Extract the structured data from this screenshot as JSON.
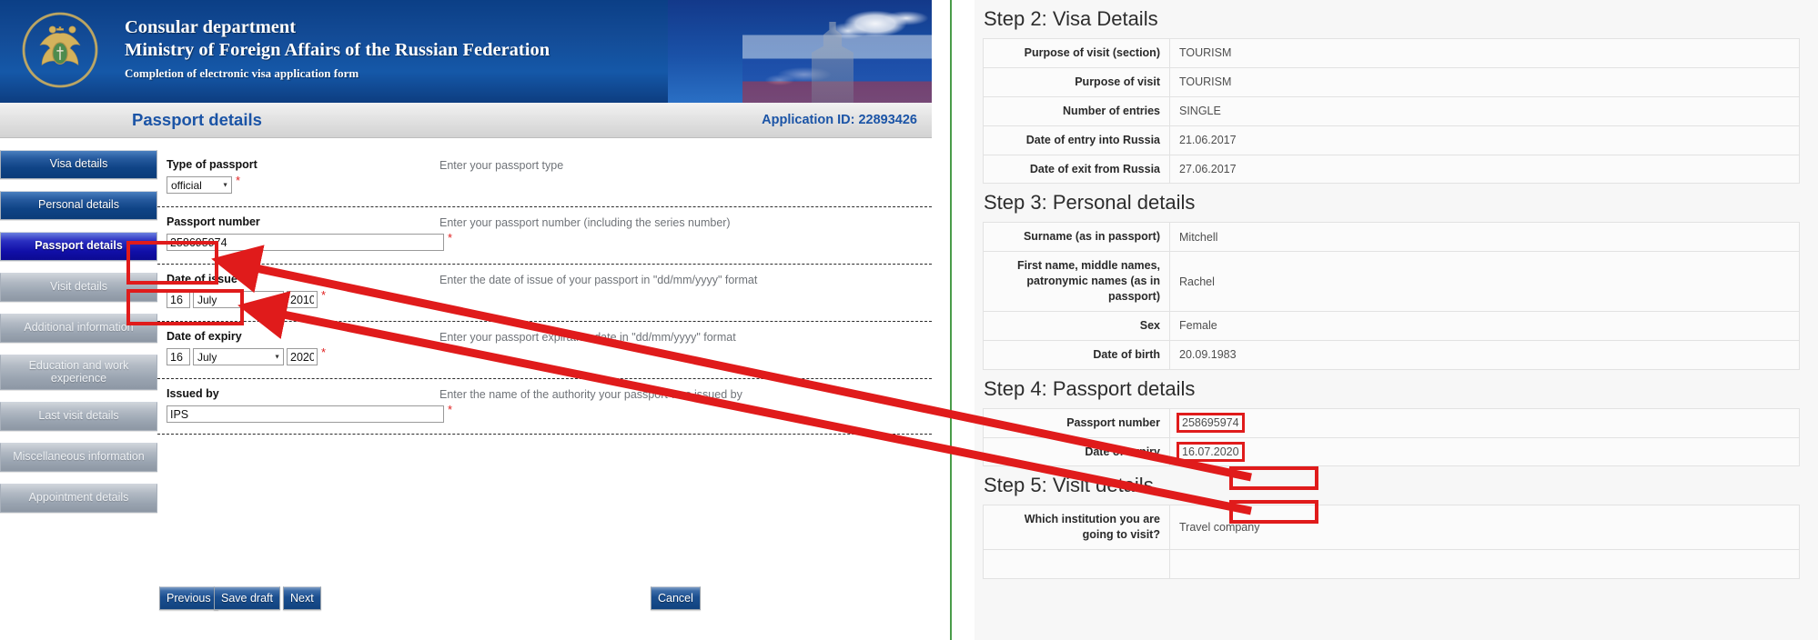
{
  "banner": {
    "line1": "Consular department",
    "line2": "Ministry of Foreign Affairs of the Russian Federation",
    "line3": "Completion of electronic visa application form",
    "emblem_alt": "russian-mfa-emblem",
    "bg_color": "#134b96"
  },
  "titlebar": {
    "title": "Passport details",
    "application_id": "Application ID: 22893426",
    "accent_color": "#1b54a6"
  },
  "sidebar": {
    "items": [
      {
        "label": "Visa details",
        "state": "done"
      },
      {
        "label": "Personal details",
        "state": "done"
      },
      {
        "label": "Passport details",
        "state": "active"
      },
      {
        "label": "Visit details",
        "state": "disabled"
      },
      {
        "label": "Additional information",
        "state": "disabled"
      },
      {
        "label": "Education and work experience",
        "state": "disabled"
      },
      {
        "label": "Last visit details",
        "state": "disabled"
      },
      {
        "label": "Miscellaneous information",
        "state": "disabled"
      },
      {
        "label": "Appointment details",
        "state": "disabled"
      }
    ]
  },
  "form": {
    "required_mark": "*",
    "rows": [
      {
        "label": "Type of passport",
        "hint": "Enter your passport type",
        "type": "select",
        "value": "official"
      },
      {
        "label": "Passport number",
        "hint": "Enter your passport number (including the series number)",
        "type": "text",
        "value": "258695974"
      },
      {
        "label": "Date of issue",
        "hint": "Enter the date of issue of your passport in \"dd/mm/yyyy\" format",
        "type": "date",
        "day": "16",
        "month": "July",
        "year": "2010"
      },
      {
        "label": "Date of expiry",
        "hint": "Enter your passport expiration date in \"dd/mm/yyyy\" format",
        "type": "date",
        "day": "16",
        "month": "July",
        "year": "2020"
      },
      {
        "label": "Issued by",
        "hint": "Enter the name of the authority your passport was issued by",
        "type": "text",
        "value": "IPS"
      }
    ]
  },
  "buttons": {
    "previous": "Previous",
    "save_draft": "Save draft",
    "next": "Next",
    "cancel": "Cancel"
  },
  "summary": {
    "steps": [
      {
        "title": "Step 2: Visa Details",
        "rows": [
          {
            "key": "Purpose of visit (section)",
            "value": "TOURISM",
            "highlight": false
          },
          {
            "key": "Purpose of visit",
            "value": "TOURISM",
            "highlight": false
          },
          {
            "key": "Number of entries",
            "value": "SINGLE",
            "highlight": false
          },
          {
            "key": "Date of entry into Russia",
            "value": "21.06.2017",
            "highlight": false
          },
          {
            "key": "Date of exit from Russia",
            "value": "27.06.2017",
            "highlight": false
          }
        ]
      },
      {
        "title": "Step 3: Personal details",
        "rows": [
          {
            "key": "Surname (as in passport)",
            "value": "Mitchell",
            "highlight": false
          },
          {
            "key": "First name, middle names, patronymic names (as in passport)",
            "value": "Rachel",
            "highlight": false
          },
          {
            "key": "Sex",
            "value": "Female",
            "highlight": false
          },
          {
            "key": "Date of birth",
            "value": "20.09.1983",
            "highlight": false
          }
        ]
      },
      {
        "title": "Step 4: Passport details",
        "rows": [
          {
            "key": "Passport number",
            "value": "258695974",
            "highlight": true
          },
          {
            "key": "Date of expiry",
            "value": "16.07.2020",
            "highlight": true
          }
        ]
      },
      {
        "title": "Step 5: Visit details",
        "rows": [
          {
            "key": "Which institution you are going to visit?",
            "value": "Travel company",
            "highlight": false
          }
        ]
      }
    ]
  },
  "annotation": {
    "color": "#e01b1b",
    "divider_color": "#4a9c4a",
    "boxes": [
      {
        "name": "passport-number-field-highlight"
      },
      {
        "name": "date-of-expiry-field-highlight"
      },
      {
        "name": "summary-passport-number-highlight"
      },
      {
        "name": "summary-date-of-expiry-highlight"
      }
    ],
    "arrows": [
      {
        "name": "passport-number-arrow"
      },
      {
        "name": "date-of-expiry-arrow"
      }
    ]
  }
}
